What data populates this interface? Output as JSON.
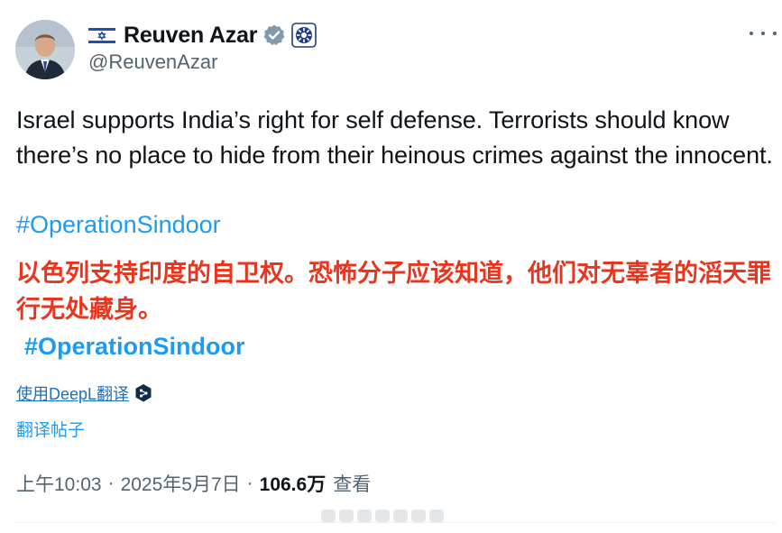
{
  "author": {
    "display_name": "Reuven Azar",
    "handle": "@ReuvenAzar",
    "flag_icon": "israel-flag-icon",
    "verified_icon": "verified-badge-icon",
    "affiliation_icon": "government-affiliation-icon"
  },
  "tweet": {
    "text": "Israel supports India’s right for self defense. Terrorists should know there’s no place to hide from their heinous crimes against the innocent.",
    "hashtag": "#OperationSindoor"
  },
  "translation_overlay": {
    "text": "以色列支持印度的自卫权。恐怖分子应该知道，他们对无辜者的滔天罪行无处藏身。",
    "hashtag": "#OperationSindoor",
    "color": "#e8361e"
  },
  "actions": {
    "deepl_label": "使用DeepL翻译",
    "translate_label": "翻译帖子"
  },
  "meta": {
    "time": "上午10:03",
    "separator": "·",
    "date": "2025年5月7日",
    "views_count": "106.6万",
    "views_label": "查看"
  },
  "colors": {
    "link": "#1d9bf0",
    "secondary_text": "#536471",
    "primary_text": "#0f1419"
  }
}
